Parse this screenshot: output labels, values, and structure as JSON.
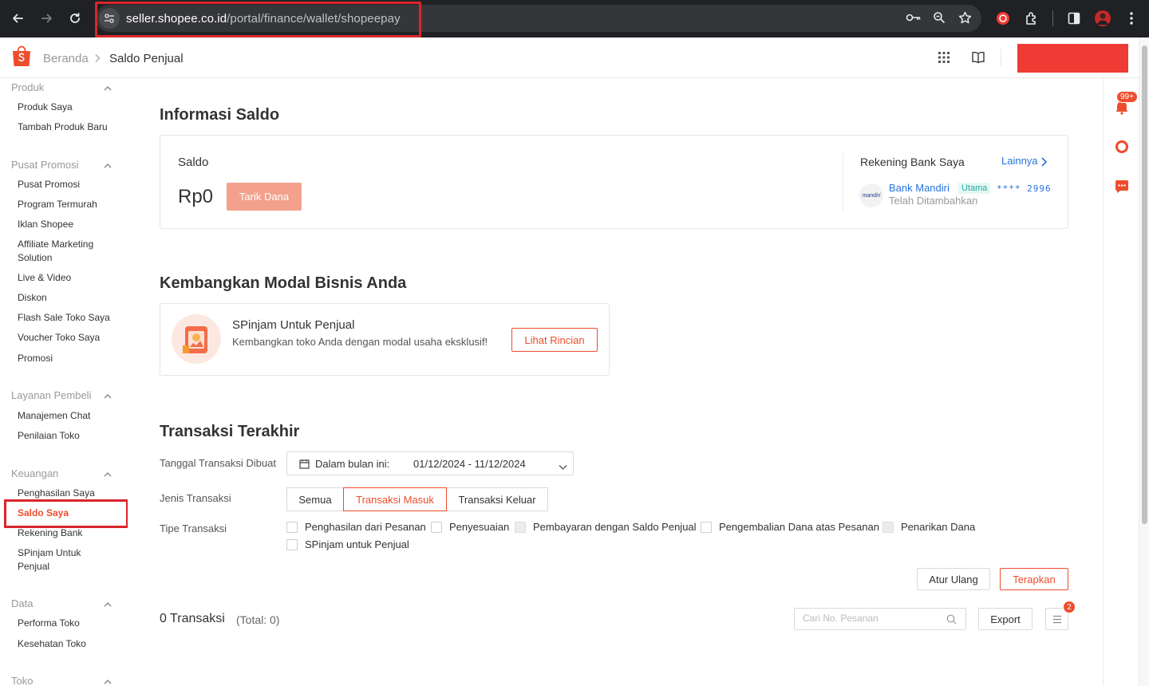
{
  "browser": {
    "url_host": "seller.shopee.co.id",
    "url_path": "/portal/finance/wallet/shopeepay"
  },
  "header": {
    "breadcrumb_home": "Beranda",
    "breadcrumb_current": "Saldo Penjual"
  },
  "sidebar": {
    "sections": [
      {
        "title": "Produk",
        "items": [
          "Produk Saya",
          "Tambah Produk Baru"
        ]
      },
      {
        "title": "Pusat Promosi",
        "items": [
          "Pusat Promosi",
          "Program Termurah",
          "Iklan Shopee",
          "Affiliate Marketing Solution",
          "Live & Video",
          "Diskon",
          "Flash Sale Toko Saya",
          "Voucher Toko Saya",
          "Promosi"
        ]
      },
      {
        "title": "Layanan Pembeli",
        "items": [
          "Manajemen Chat",
          "Penilaian Toko"
        ]
      },
      {
        "title": "Keuangan",
        "items": [
          "Penghasilan Saya",
          "Saldo Saya",
          "Rekening Bank",
          "SPinjam Untuk Penjual"
        ]
      },
      {
        "title": "Data",
        "items": [
          "Performa Toko",
          "Kesehatan Toko"
        ]
      },
      {
        "title": "Toko",
        "items": []
      }
    ],
    "active_item": "Saldo Saya"
  },
  "right_rail": {
    "notification_badge": "99+"
  },
  "saldo_info": {
    "title": "Informasi Saldo",
    "saldo_label": "Saldo",
    "amount": "Rp0",
    "withdraw_button": "Tarik Dana",
    "bank_title": "Rekening Bank Saya",
    "more_link": "Lainnya",
    "bank_name": "Bank Mandiri",
    "bank_tag": "Utama",
    "bank_number": "**** 2996",
    "bank_status": "Telah Ditambahkan",
    "bank_logo_text": "mandiri"
  },
  "business": {
    "title": "Kembangkan Modal Bisnis Anda",
    "card_title": "SPinjam Untuk Penjual",
    "card_desc": "Kembangkan toko Anda dengan modal usaha eksklusif!",
    "button": "Lihat Rincian"
  },
  "transactions": {
    "title": "Transaksi Terakhir",
    "date_label": "Tanggal Transaksi Dibuat",
    "date_prefix": "Dalam bulan ini:",
    "date_range": "01/12/2024 - 11/12/2024",
    "type_label": "Jenis Transaksi",
    "type_options": [
      "Semua",
      "Transaksi Masuk",
      "Transaksi Keluar"
    ],
    "type_selected": "Transaksi Masuk",
    "subtype_label": "Tipe Transaksi",
    "subtypes": [
      {
        "label": "Penghasilan dari Pesanan",
        "checked": false,
        "disabled": false
      },
      {
        "label": "Penyesuaian",
        "checked": false,
        "disabled": false
      },
      {
        "label": "Pembayaran dengan Saldo Penjual",
        "checked": false,
        "disabled": true
      },
      {
        "label": "Pengembalian Dana atas Pesanan",
        "checked": false,
        "disabled": false
      },
      {
        "label": "Penarikan Dana",
        "checked": false,
        "disabled": true
      },
      {
        "label": "SPinjam untuk Penjual",
        "checked": false,
        "disabled": false
      }
    ],
    "reset_button": "Atur Ulang",
    "apply_button": "Terapkan",
    "count_text": "0 Transaksi",
    "total_text": "(Total: 0)",
    "search_placeholder": "Cari No. Pesanan",
    "export_button": "Export",
    "columns_badge": "2"
  },
  "colors": {
    "accent": "#ee4d2d",
    "link": "#2673dd",
    "highlight_box": "#d9262c"
  }
}
